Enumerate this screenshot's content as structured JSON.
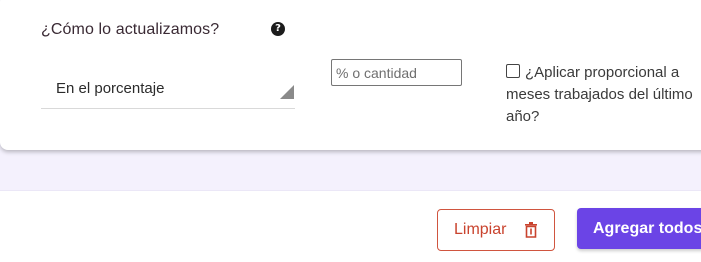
{
  "form": {
    "question": "¿Cómo lo actualizamos?",
    "help_icon": "question-circle-icon",
    "method_select": {
      "selected": "En el porcentaje"
    },
    "amount_input": {
      "value": "",
      "placeholder": "% o cantidad"
    },
    "prorate": {
      "checked": false,
      "label": "¿Aplicar proporcional a meses trabajados del último año?"
    }
  },
  "actions": {
    "clear_label": "Limpiar",
    "clear_icon": "trash-icon",
    "add_all_label": "Agregar todos"
  },
  "colors": {
    "accent": "#6b44e6",
    "danger": "#c9432e",
    "background_band": "#f4f1fd"
  }
}
